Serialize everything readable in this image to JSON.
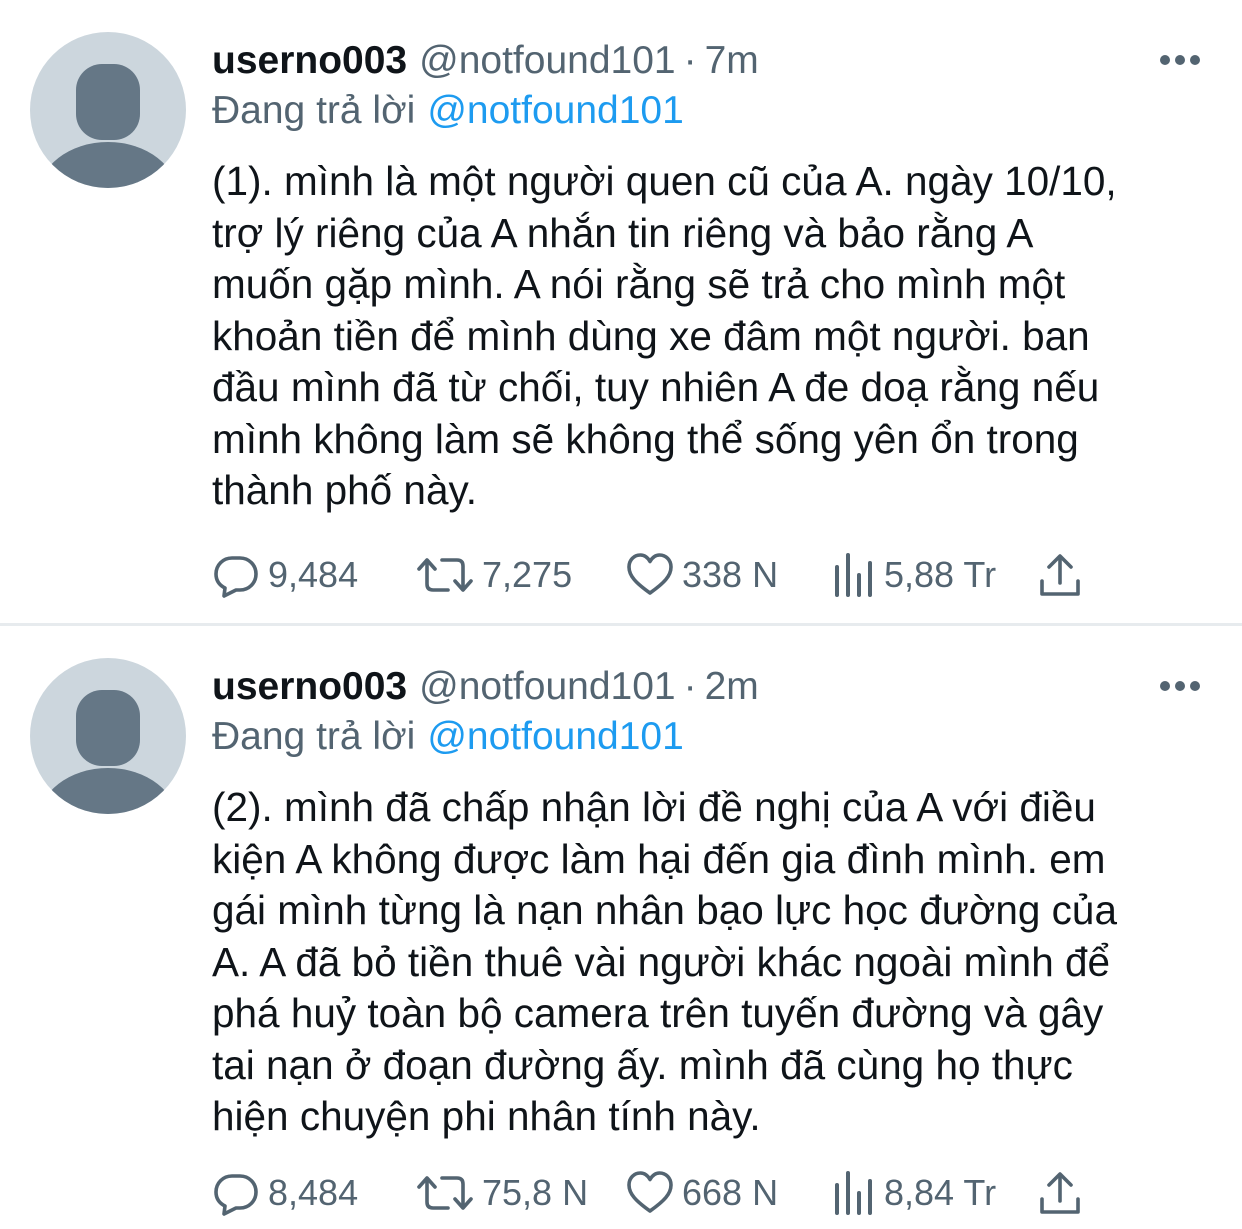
{
  "colors": {
    "text_primary": "#0f1419",
    "text_secondary": "#536471",
    "link": "#1d9bf0",
    "avatar_bg": "#ccd6dd",
    "avatar_fg": "#657786",
    "divider": "#e7ebee"
  },
  "tweets": [
    {
      "username": "userno003",
      "handle": "@notfound101",
      "separator": "·",
      "time": "7m",
      "replying_label": "Đang trả lời",
      "replying_to": "@notfound101",
      "text": "(1). mình là một người quen cũ của A. ngày 10/10,\ntrợ lý riêng của A nhắn tin riêng và bảo rằng A\nmuốn gặp mình. A nói rằng sẽ trả cho mình một\nkhoản tiền để mình dùng xe đâm một người. ban\nđầu mình đã từ chối, tuy nhiên A đe doạ rằng nếu\nmình không làm sẽ không thể sống yên ổn trong\nthành phố này.",
      "replies": "9,484",
      "retweets": "7,275",
      "likes": "338 N",
      "views": "5,88 Tr"
    },
    {
      "username": "userno003",
      "handle": "@notfound101",
      "separator": "·",
      "time": "2m",
      "replying_label": "Đang trả lời",
      "replying_to": "@notfound101",
      "text": "(2). mình đã chấp nhận lời đề nghị của A với điều\nkiện A không được làm hại đến gia đình mình. em\ngái mình từng là nạn nhân bạo lực học đường của\nA. A đã bỏ tiền thuê vài người khác ngoài mình để\nphá huỷ toàn bộ camera trên tuyến đường và gây\ntai nạn ở đoạn đường ấy. mình đã cùng họ thực\nhiện chuyện phi nhân tính này.",
      "replies": "8,484",
      "retweets": "75,8 N",
      "likes": "668 N",
      "views": "8,84 Tr"
    }
  ],
  "icons": {
    "avatar": "default-avatar-icon",
    "more": "more-dots-icon",
    "reply": "reply-bubble-icon",
    "retweet": "retweet-icon",
    "like": "heart-icon",
    "views": "views-bar-chart-icon",
    "share": "share-upload-icon"
  }
}
